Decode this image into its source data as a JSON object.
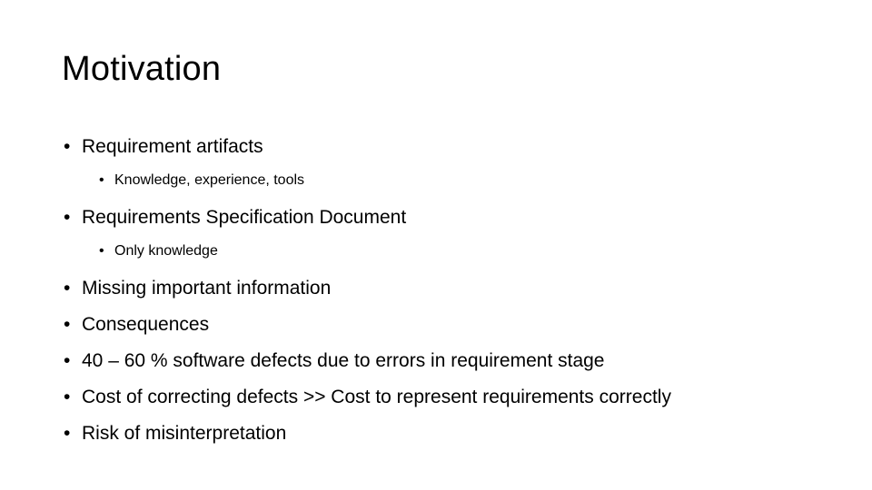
{
  "slide": {
    "title": "Motivation",
    "background_color": "#ffffff",
    "text_color": "#000000",
    "bullet_glyph": "•",
    "content": [
      {
        "level": 1,
        "text": "Requirement artifacts",
        "children": [
          {
            "level": 2,
            "text": "Knowledge, experience, tools"
          }
        ]
      },
      {
        "level": 1,
        "text": "Requirements Specification Document",
        "children": [
          {
            "level": 2,
            "text": "Only knowledge"
          }
        ]
      },
      {
        "level": 1,
        "text": "Missing important information",
        "children": []
      },
      {
        "level": 1,
        "text": "Consequences",
        "children": []
      },
      {
        "level": 1,
        "text": "40 – 60 % software defects due to errors in requirement stage",
        "children": []
      },
      {
        "level": 1,
        "text": "Cost of correcting defects >> Cost to represent requirements correctly",
        "children": []
      },
      {
        "level": 1,
        "text": "Risk of misinterpretation",
        "children": []
      }
    ]
  }
}
